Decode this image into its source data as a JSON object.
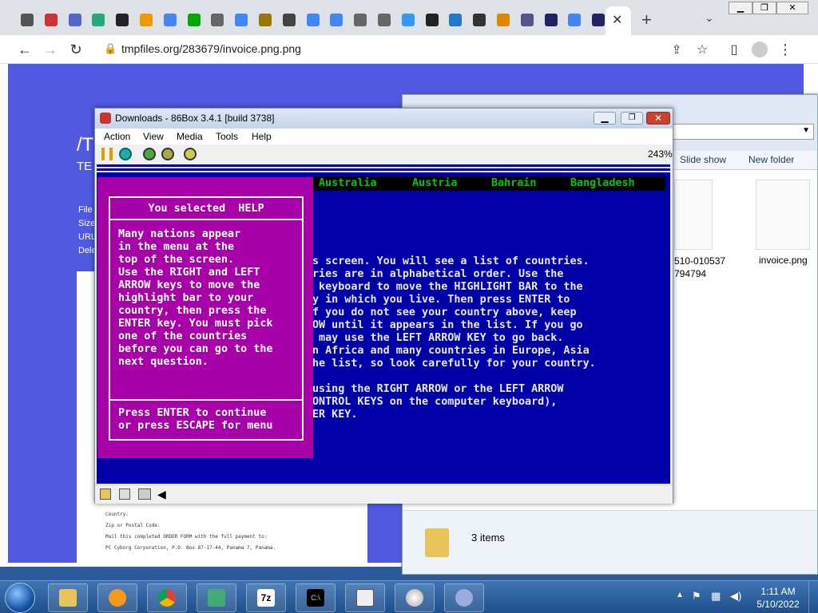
{
  "browser": {
    "url": "tmpfiles.org/283679/invoice.png.png",
    "tabs_icons": [
      "vb",
      "red-square",
      "sigma",
      "play-box",
      "bike",
      "diamond",
      "google",
      "avatar-a",
      "globe",
      "google",
      "uio",
      "image",
      "google",
      "google",
      "globe",
      "globe",
      "cloud",
      "github",
      "download",
      "SL",
      "E",
      "save",
      "sw",
      "google",
      "sw"
    ],
    "new_tab_label": "+",
    "page": {
      "title_fragment": "/T",
      "subtitle_fragment": "TE",
      "side_labels": [
        "File",
        "Size",
        "URL",
        "Dele"
      ],
      "form_lines": [
        "Country:",
        "Zip or Postal Code:",
        "Mail this completed ORDER FORM with the full payment to:",
        "PC Cyborg Corporation, P.O. Box 87-17-44, Panama 7, Panama."
      ]
    }
  },
  "explorer": {
    "toolbar": [
      "Slide show",
      "New folder"
    ],
    "files": [
      {
        "name": "510-010537\n794794"
      },
      {
        "name": "invoice.png"
      }
    ],
    "status": "3 items"
  },
  "emulator": {
    "title": "Downloads - 86Box 3.4.1 [build 3738]",
    "menu": [
      "Action",
      "View",
      "Media",
      "Tools",
      "Help"
    ],
    "zoom": "243%",
    "countries": [
      "Australia",
      "Austria",
      "Bahrain",
      "Bangladesh"
    ],
    "help_title": "You selected  HELP",
    "help_body": [
      "Many nations appear",
      "in the menu at the",
      "top of the screen.",
      "Use the RIGHT and LEFT",
      "ARROW keys to move the",
      "highlight bar to your",
      "country, then press the",
      "ENTER key. You must pick",
      "one of the countries",
      "before you can go to the",
      "next question."
    ],
    "help_footer": [
      "Press ENTER to continue",
      "or press ESCAPE for menu"
    ],
    "bg_lines": [
      "s screen. You will see a list of countries.",
      "ries are in alphabetical order. Use the",
      " keyboard to move the HIGHLIGHT BAR to the",
      "y in which you live. Then press ENTER to",
      "f you do not see your country above, keep",
      "OW until it appears in the list. If you go",
      " may use the LEFT ARROW KEY to go back.",
      "n Africa and many countries in Europe, Asia",
      "he list, so look carefully for your country.",
      "",
      "using the RIGHT ARROW or the LEFT ARROW",
      "ONTROL KEYS on the computer keyboard),",
      "ER KEY."
    ]
  },
  "taskbar": {
    "time": "1:11 AM",
    "date": "5/10/2022",
    "apps": [
      "Windows Explorer",
      "Media Player",
      "Chrome",
      "86Box",
      "7-Zip",
      "Command Prompt",
      "Notepad",
      "Disc",
      "Paint"
    ]
  },
  "colors": {
    "emu_bg": "#0000a8",
    "help_bg": "#a800a8",
    "country": "#00c800",
    "page_bg": "#5059e0"
  }
}
